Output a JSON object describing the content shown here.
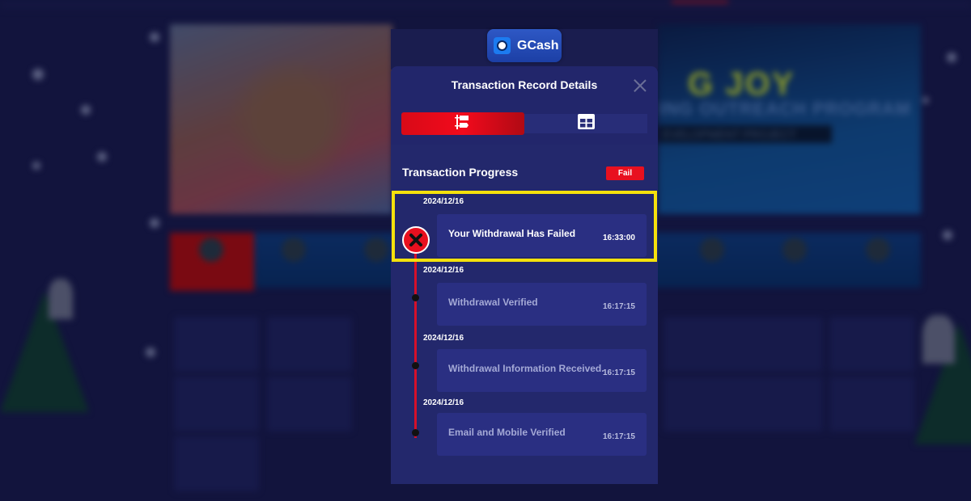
{
  "background": {
    "banner_text_1": "G JOY",
    "banner_text_2": "ING OUTREACH PROGRAM",
    "banner_text_3": "EVELOPMENT PROJECT"
  },
  "payment_method": {
    "name": "GCash",
    "icon": "gcash-logo-icon"
  },
  "modal": {
    "title": "Transaction Record Details",
    "close_icon": "close-icon",
    "tabs": [
      {
        "icon": "timeline-icon",
        "active": true
      },
      {
        "icon": "grid-icon",
        "active": false
      }
    ],
    "progress": {
      "title": "Transaction Progress",
      "status_badge": "Fail",
      "steps": [
        {
          "date": "2024/12/16",
          "label": "Your Withdrawal Has Failed",
          "time": "16:33:00",
          "state": "failed",
          "highlighted": true
        },
        {
          "date": "2024/12/16",
          "label": "Withdrawal Verified",
          "time": "16:17:15",
          "state": "done"
        },
        {
          "date": "2024/12/16",
          "label": "Withdrawal Information Received.",
          "time": "16:17:15",
          "state": "done"
        },
        {
          "date": "2024/12/16",
          "label": "Email and Mobile Verified",
          "time": "16:17:15",
          "state": "done"
        }
      ]
    }
  },
  "colors": {
    "accent_red": "#e8101f",
    "modal_bg": "#22266b",
    "card_bg": "#2a2f82",
    "highlight": "#f5e10c",
    "gcash_blue": "#2e58c5"
  }
}
